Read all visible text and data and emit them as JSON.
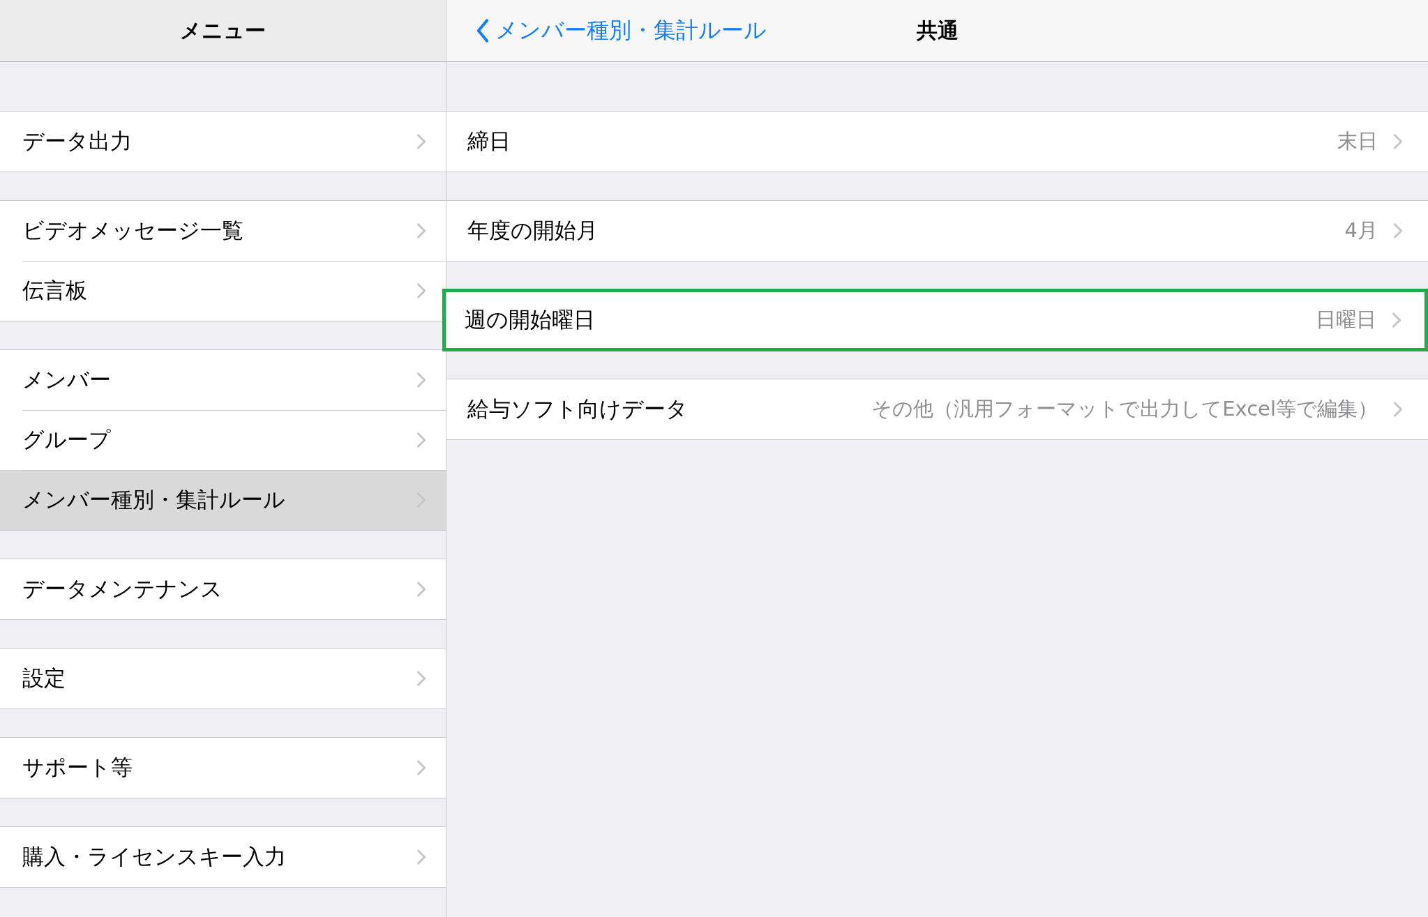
{
  "menu": {
    "title": "メニュー",
    "groups": [
      [
        {
          "label": "データ出力",
          "selected": false
        }
      ],
      [
        {
          "label": "ビデオメッセージ一覧",
          "selected": false
        },
        {
          "label": "伝言板",
          "selected": false
        }
      ],
      [
        {
          "label": "メンバー",
          "selected": false
        },
        {
          "label": "グループ",
          "selected": false
        },
        {
          "label": "メンバー種別・集計ルール",
          "selected": true
        }
      ],
      [
        {
          "label": "データメンテナンス",
          "selected": false
        }
      ],
      [
        {
          "label": "設定",
          "selected": false
        }
      ],
      [
        {
          "label": "サポート等",
          "selected": false
        }
      ],
      [
        {
          "label": "購入・ライセンスキー入力",
          "selected": false
        }
      ]
    ]
  },
  "detail": {
    "back_label": "メンバー種別・集計ルール",
    "title": "共通",
    "rows": [
      {
        "label": "締日",
        "value": "末日",
        "highlighted": false
      },
      {
        "label": "年度の開始月",
        "value": "4月",
        "highlighted": false
      },
      {
        "label": "週の開始曜日",
        "value": "日曜日",
        "highlighted": true
      },
      {
        "label": "給与ソフト向けデータ",
        "value": "その他（汎用フォーマットで出力してExcel等で編集）",
        "highlighted": false
      }
    ]
  }
}
